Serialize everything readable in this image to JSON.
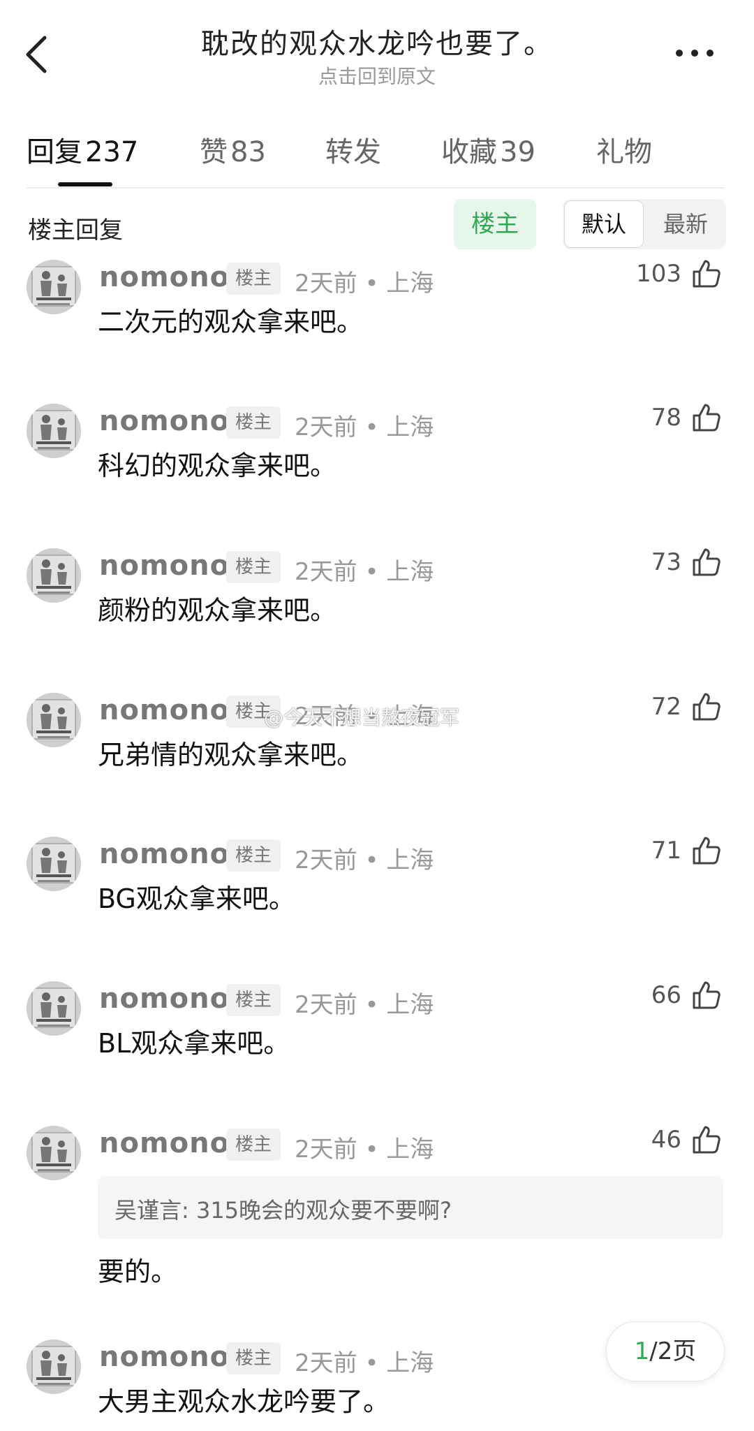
{
  "header": {
    "title": "耽改的观众水龙吟也要了。",
    "subtitle": "点击回到原文",
    "back_icon": "chevron-left-icon",
    "more_icon": "more-horizontal-icon"
  },
  "tabs": [
    {
      "label": "回复",
      "count": "237"
    },
    {
      "label": "赞",
      "count": "83"
    },
    {
      "label": "转发",
      "count": ""
    },
    {
      "label": "收藏",
      "count": "39"
    },
    {
      "label": "礼物",
      "count": ""
    }
  ],
  "filter": {
    "title": "楼主回复",
    "op_chip": "楼主",
    "sort_default": "默认",
    "sort_latest": "最新"
  },
  "comments": [
    {
      "author": "nomono",
      "badge": "楼主",
      "meta": "2天前 • 上海",
      "likes": "103",
      "text": "二次元的观众拿来吧。"
    },
    {
      "author": "nomono",
      "badge": "楼主",
      "meta": "2天前 • 上海",
      "likes": "78",
      "text": "科幻的观众拿来吧。"
    },
    {
      "author": "nomono",
      "badge": "楼主",
      "meta": "2天前 • 上海",
      "likes": "73",
      "text": "颜粉的观众拿来吧。"
    },
    {
      "author": "nomono",
      "badge": "楼主",
      "meta": "2天前 • 上海",
      "likes": "72",
      "text": "兄弟情的观众拿来吧。"
    },
    {
      "author": "nomono",
      "badge": "楼主",
      "meta": "2天前 • 上海",
      "likes": "71",
      "text": "BG观众拿来吧。"
    },
    {
      "author": "nomono",
      "badge": "楼主",
      "meta": "2天前 • 上海",
      "likes": "66",
      "text": "BL观众拿来吧。"
    },
    {
      "author": "nomono",
      "badge": "楼主",
      "meta": "2天前 • 上海",
      "likes": "46",
      "quote": "吴谨言: 315晚会的观众要不要啊?",
      "text": "要的。"
    },
    {
      "author": "nomono",
      "badge": "楼主",
      "meta": "2天前 • 上海",
      "likes": "",
      "text": "大男主观众水龙吟要了。"
    }
  ],
  "watermark": "@今天不想当熬夜冠军",
  "pager": {
    "current": "1",
    "total": "/2页"
  },
  "colors": {
    "accent_green": "#33a852",
    "badge_bg": "#f0f0f0",
    "op_chip_bg": "#e6f6ea"
  }
}
